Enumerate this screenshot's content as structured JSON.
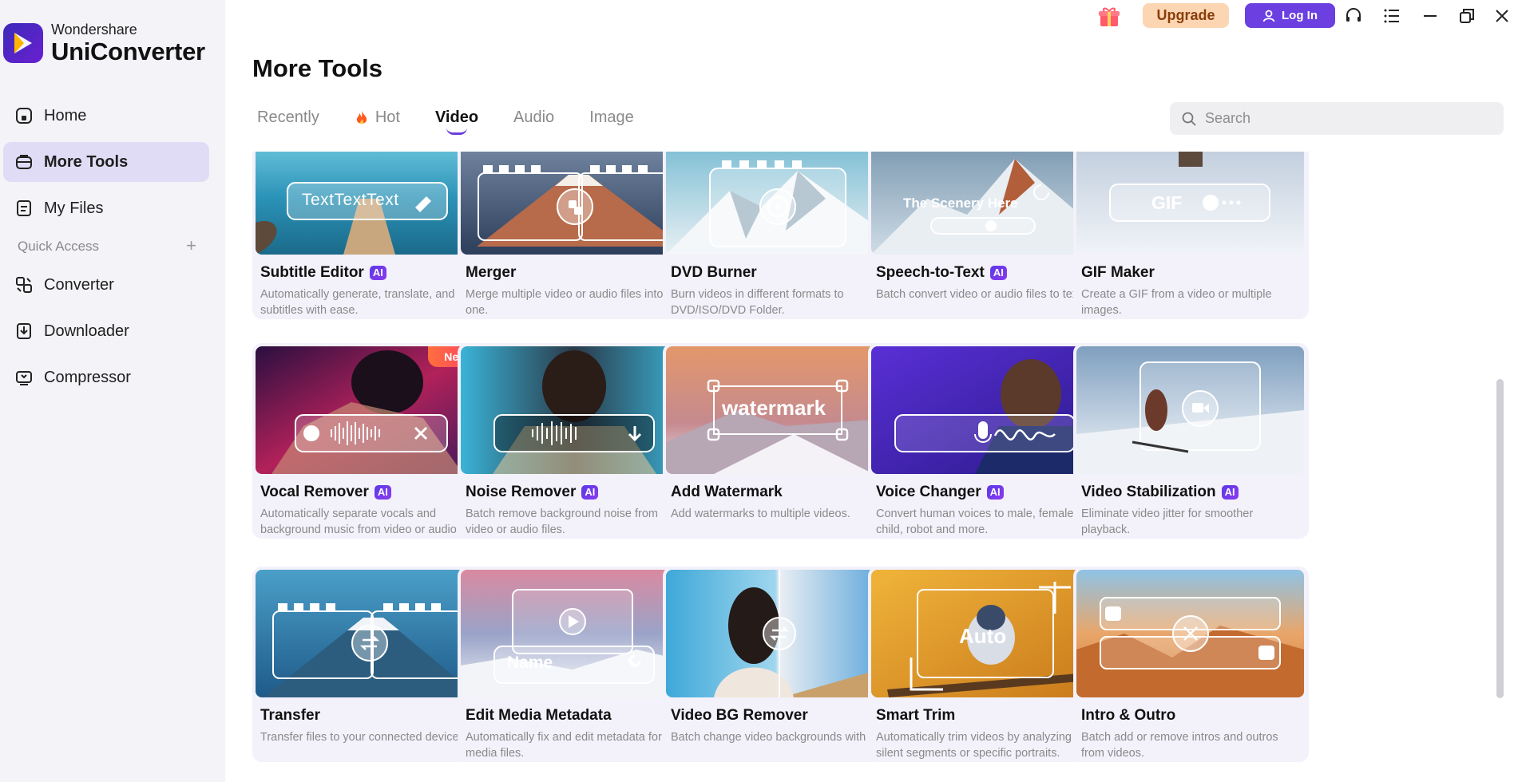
{
  "app": {
    "brand_small": "Wondershare",
    "brand_big": "UniConverter"
  },
  "nav": {
    "home": "Home",
    "more_tools": "More Tools",
    "my_files": "My Files",
    "quick_access": "Quick Access",
    "converter": "Converter",
    "downloader": "Downloader",
    "compressor": "Compressor"
  },
  "topbar": {
    "upgrade": "Upgrade",
    "login": "Log In"
  },
  "page": {
    "title": "More Tools"
  },
  "tabs": {
    "recently": "Recently",
    "hot": "Hot",
    "video": "Video",
    "audio": "Audio",
    "image": "Image"
  },
  "search": {
    "placeholder": "Search"
  },
  "badges": {
    "ai": "AI",
    "new": "New"
  },
  "colors": {
    "accent": "#6b3fe0",
    "upgrade_bg": "#fcd6b3",
    "sidebar_active": "#e1dcf5"
  },
  "cards": [
    {
      "name": "Subtitle Editor",
      "ai": true,
      "desc": "Automatically generate, translate, and edit subtitles with ease.",
      "thumb_text": "TextTextText"
    },
    {
      "name": "Merger",
      "ai": false,
      "desc": "Merge multiple video or audio files into one."
    },
    {
      "name": "DVD Burner",
      "ai": false,
      "desc": "Burn videos in different formats to DVD/ISO/DVD Folder."
    },
    {
      "name": "Speech-to-Text",
      "ai": true,
      "desc": "Batch convert video or audio files to text.",
      "thumb_text": "The Scenery Here"
    },
    {
      "name": "GIF Maker",
      "ai": false,
      "desc": "Create a GIF from a video or multiple images.",
      "thumb_text": "GIF"
    },
    {
      "name": "Vocal Remover",
      "ai": true,
      "desc": "Automatically separate vocals and background music from video or audio ...",
      "new": true
    },
    {
      "name": "Noise Remover",
      "ai": true,
      "desc": "Batch remove background noise from video or audio files."
    },
    {
      "name": "Add Watermark",
      "ai": false,
      "desc": "Add watermarks to multiple videos.",
      "thumb_text": "watermark"
    },
    {
      "name": "Voice Changer",
      "ai": true,
      "desc": "Convert human voices to male, female, child, robot and more."
    },
    {
      "name": "Video Stabilization",
      "ai": true,
      "desc": "Eliminate video jitter for smoother playback."
    },
    {
      "name": "Transfer",
      "ai": false,
      "desc": "Transfer files to your connected device."
    },
    {
      "name": "Edit Media Metadata",
      "ai": false,
      "desc": "Automatically fix and edit metadata for media files.",
      "thumb_text": "Name"
    },
    {
      "name": "Video BG Remover",
      "ai": false,
      "desc": "Batch change video backgrounds with AI."
    },
    {
      "name": "Smart Trim",
      "ai": false,
      "desc": "Automatically trim videos by analyzing silent segments or specific portraits.",
      "thumb_text": "Auto"
    },
    {
      "name": "Intro & Outro",
      "ai": false,
      "desc": "Batch add or remove intros and outros from videos."
    }
  ]
}
